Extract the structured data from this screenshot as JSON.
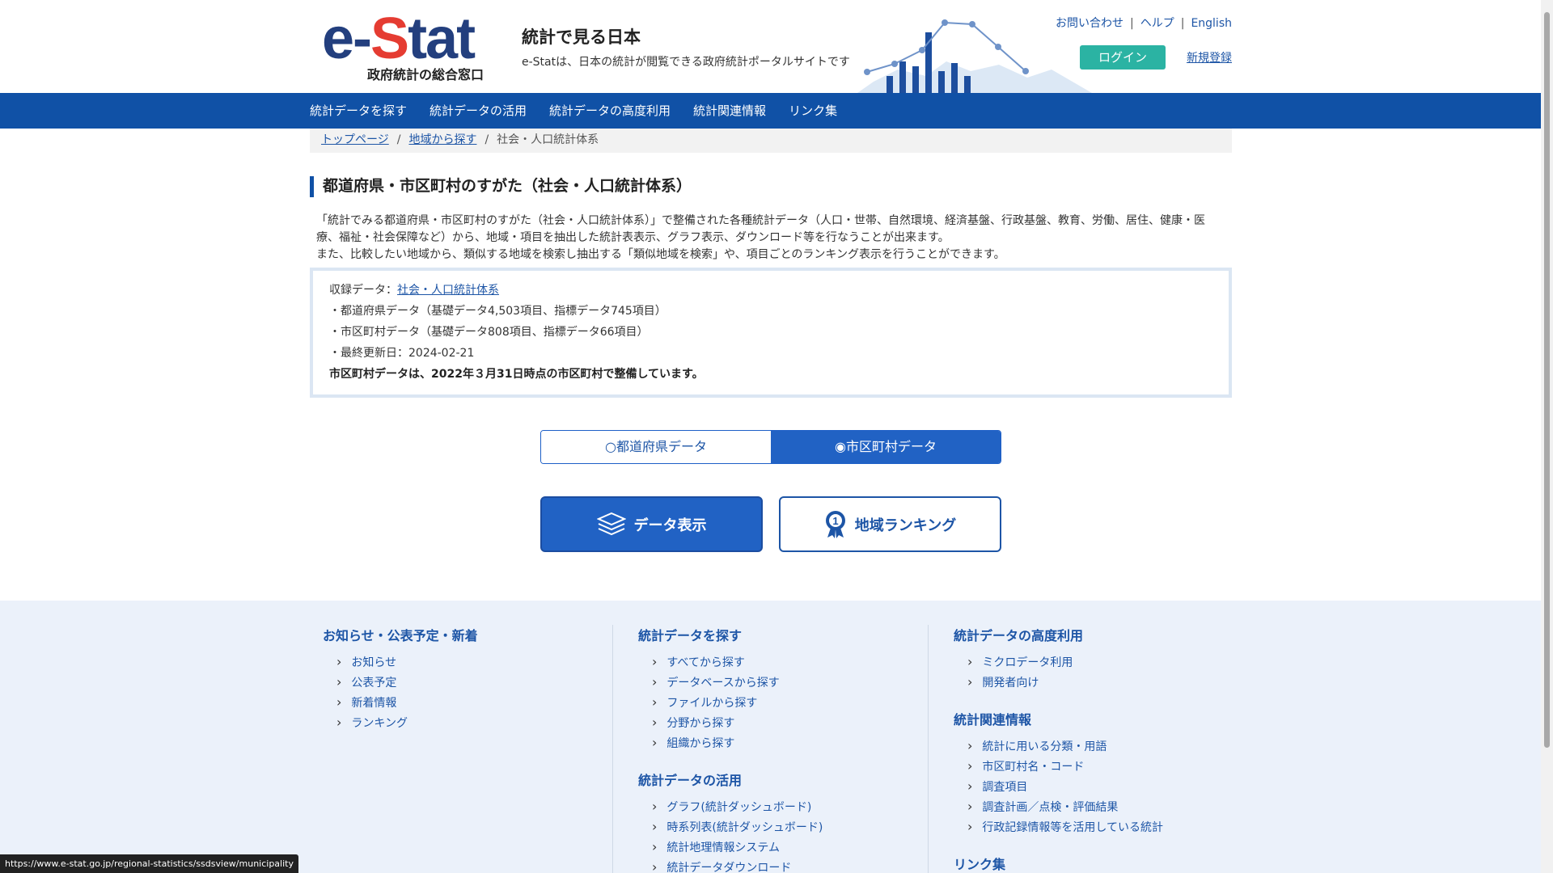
{
  "header": {
    "logo_main_a": "e-",
    "logo_main_s": "S",
    "logo_main_b": "tat",
    "logo_sub": "政府統計の総合窓口",
    "site_title": "統計で見る日本",
    "site_desc": "e-Statは、日本の統計が閲覧できる政府統計ポータルサイトです",
    "links": [
      "お問い合わせ",
      "ヘルプ",
      "English"
    ],
    "separator": "|",
    "login": "ログイン",
    "register": "新規登録"
  },
  "nav": {
    "items": [
      "統計データを探す",
      "統計データの活用",
      "統計データの高度利用",
      "統計関連情報",
      "リンク集"
    ]
  },
  "breadcrumb": {
    "items": [
      "トップページ",
      "地域から探す",
      "社会・人口統計体系"
    ],
    "separator": "/"
  },
  "main": {
    "title": "都道府県・市区町村のすがた（社会・人口統計体系）",
    "intro_1": "「統計でみる都道府県・市区町村のすがた（社会・人口統計体系）」で整備された各種統計データ（人口・世帯、自然環境、経済基盤、行政基盤、教育、労働、居住、健康・医",
    "intro_2": "療、福祉・社会保障など）から、地域・項目を抽出した統計表表示、グラフ表示、ダウンロード等を行なうことが出来ます。",
    "intro_3": "また、比較したい地域から、類似する地域を検索し抽出する「類似地域を検索」や、項目ごとのランキング表示を行うことができます。",
    "info": {
      "label": "収録データ：",
      "link": "社会・人口統計体系",
      "line1": "・都道府県データ（基礎データ4,503項目、指標データ745項目）",
      "line2": "・市区町村データ（基礎データ808項目、指標データ66項目）",
      "line3": "・最終更新日：2024-02-21",
      "note": "市区町村データは、2022年３月31日時点の市区町村で整備しています。"
    },
    "toggle": {
      "prefecture": "都道府県データ",
      "municipality": "市区町村データ",
      "selected": "市区町村データ"
    },
    "btn_data": "データ表示",
    "btn_rank": "地域ランキング"
  },
  "footer": {
    "col1": {
      "title": "お知らせ・公表予定・新着",
      "items": [
        "お知らせ",
        "公表予定",
        "新着情報",
        "ランキング"
      ]
    },
    "col2": {
      "title": "統計データを探す",
      "items": [
        "すべてから探す",
        "データベースから探す",
        "ファイルから探す",
        "分野から探す",
        "組織から探す"
      ],
      "title2": "統計データの活用",
      "items2": [
        "グラフ(統計ダッシュボード)",
        "時系列表(統計ダッシュボード)",
        "統計地理情報システム",
        "統計データダウンロード"
      ]
    },
    "col3": {
      "title": "統計データの高度利用",
      "items": [
        "ミクロデータ利用",
        "開発者向け"
      ],
      "title2": "統計関連情報",
      "items2": [
        "統計に用いる分類・用語",
        "市区町村名・コード",
        "調査項目",
        "調査計画／点検・評価結果",
        "行政記録情報等を活用している統計"
      ],
      "title3": "リンク集"
    }
  },
  "status_url": "https://www.e-stat.go.jp/regional-statistics/ssdsview/municipality",
  "colors": {
    "nav": "#1051a6",
    "accent": "#2162c4",
    "login": "#2bb3a3",
    "logo_blue": "#233f7e",
    "logo_red": "#e53c32"
  }
}
